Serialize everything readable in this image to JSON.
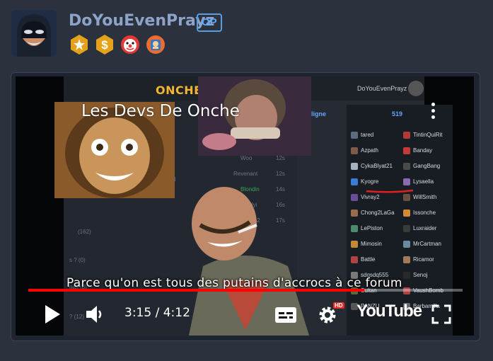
{
  "profile": {
    "username": "DoYouEvenPrayz",
    "op_label": "OP",
    "badges": [
      "star-badge-icon",
      "dollar-badge-icon",
      "clown-badge-icon",
      "frame-badge-icon"
    ]
  },
  "video": {
    "title": "Les Devs De Onche",
    "subtitle": "Parce qu'on est tous des putains d'accrocs à ce forum",
    "current_time": "3:15",
    "duration": "4:12",
    "time_separator": " / ",
    "progress_fraction": 0.774,
    "hd_label": "HD",
    "youtube_label": "YouTube"
  },
  "forum_screenshot": {
    "logo": "ONCHE",
    "top_user": "DoYouEvenPrayz",
    "online_label": "ligne",
    "online_count": "519",
    "members_left": [
      "tared",
      "Azpath",
      "CykaBlyat21",
      "Kyogre",
      "Vivray2",
      "Chong2LaGa",
      "LePiston",
      "Mimosin",
      "Battle",
      "sdqsdq555",
      "Sultan",
      "PANZU"
    ],
    "members_right": [
      "TintinQuiRit",
      "Banday",
      "GangBang",
      "Lysaella",
      "WillSmith",
      "Issonche",
      "Luxraider",
      "MrCartman",
      "Ricamor",
      "Senoj",
      "VaushBomb",
      "Barbamilla"
    ]
  },
  "colors": {
    "background": "#2b313d",
    "username": "#8da3c8",
    "op_badge": "#5fa9ff",
    "progress": "#ff0000"
  }
}
